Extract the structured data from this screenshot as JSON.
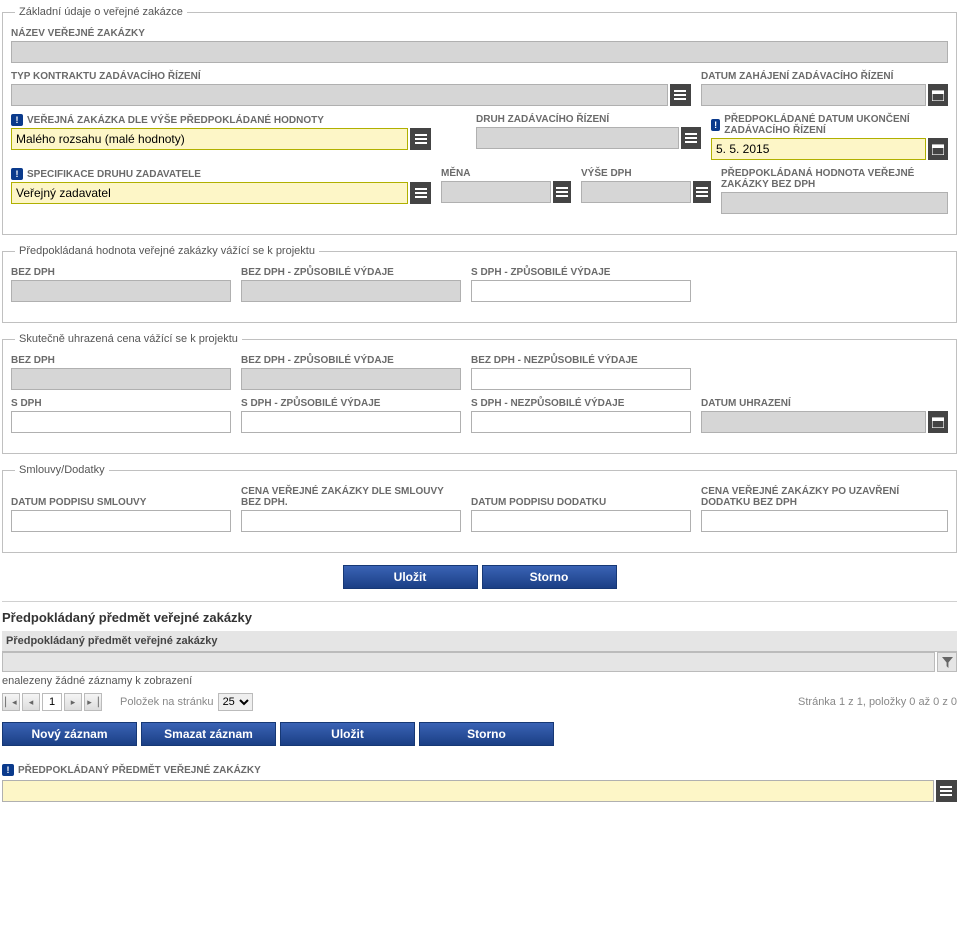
{
  "fs1": {
    "legend": "Základní údaje o veřejné zakázce",
    "nazev_lbl": "NÁZEV VEŘEJNÉ ZAKÁZKY",
    "typ_kontraktu_lbl": "TYP KONTRAKTU ZADÁVACÍHO ŘÍZENÍ",
    "datum_zahajeni_lbl": "DATUM ZAHÁJENÍ ZADÁVACÍHO ŘÍZENÍ",
    "vz_dle_vyse_lbl": "VEŘEJNÁ ZAKÁZKA DLE VÝŠE PŘEDPOKLÁDANÉ HODNOTY",
    "vz_dle_vyse_val": "Malého rozsahu (malé hodnoty)",
    "druh_lbl": "DRUH ZADÁVACÍHO ŘÍZENÍ",
    "predp_datum_uk_lbl": "PŘEDPOKLÁDANÉ DATUM UKONČENÍ ZADÁVACÍHO ŘÍZENÍ",
    "predp_datum_uk_val": "5. 5. 2015",
    "spec_druhu_lbl": "SPECIFIKACE DRUHU ZADAVATELE",
    "spec_druhu_val": "Veřejný zadavatel",
    "mena_lbl": "MĚNA",
    "vyse_dph_lbl": "VÝŠE DPH",
    "predp_hodnota_lbl": "PŘEDPOKLÁDANÁ HODNOTA VEŘEJNÉ ZAKÁZKY BEZ DPH"
  },
  "fs2": {
    "legend": "Předpokládaná hodnota veřejné zakázky vážící se k projektu",
    "bez_dph_lbl": "BEZ DPH",
    "bez_dph_zp_lbl": "BEZ DPH - ZPŮSOBILÉ VÝDAJE",
    "s_dph_zp_lbl": "S DPH - ZPŮSOBILÉ VÝDAJE"
  },
  "fs3": {
    "legend": "Skutečně uhrazená cena vážící se k projektu",
    "bez_dph_lbl": "BEZ DPH",
    "bez_dph_zp_lbl": "BEZ DPH - ZPŮSOBILÉ VÝDAJE",
    "bez_dph_nezp_lbl": "BEZ DPH - NEZPŮSOBILÉ VÝDAJE",
    "s_dph_lbl": "S DPH",
    "s_dph_zp_lbl": "S DPH - ZPŮSOBILÉ VÝDAJE",
    "s_dph_nezp_lbl": "S DPH - NEZPŮSOBILÉ VÝDAJE",
    "datum_uhr_lbl": "DATUM UHRAZENÍ"
  },
  "fs4": {
    "legend": "Smlouvy/Dodatky",
    "datum_podpisu_sml_lbl": "DATUM PODPISU SMLOUVY",
    "cena_sml_lbl": "CENA VEŘEJNÉ ZAKÁZKY DLE SMLOUVY BEZ DPH.",
    "datum_podpisu_dod_lbl": "DATUM PODPISU DODATKU",
    "cena_dod_lbl": "CENA VEŘEJNÉ ZAKÁZKY PO UZAVŘENÍ DODATKU BEZ DPH"
  },
  "buttons": {
    "ulozit": "Uložit",
    "storno": "Storno",
    "novy": "Nový záznam",
    "smazat": "Smazat záznam"
  },
  "grid": {
    "title": "Předpokládaný předmět veřejné zakázky",
    "col1": "Předpokládaný předmět veřejné zakázky",
    "empty": "enalezeny žádné záznamy k zobrazení",
    "items_per_lbl": "Položek na stránku",
    "items_per_val": "25",
    "page_val": "1",
    "status": "Stránka 1 z 1, položky 0 až 0 z 0"
  },
  "bottom": {
    "lbl": "PŘEDPOKLÁDANÝ PŘEDMĚT VEŘEJNÉ ZAKÁZKY"
  }
}
